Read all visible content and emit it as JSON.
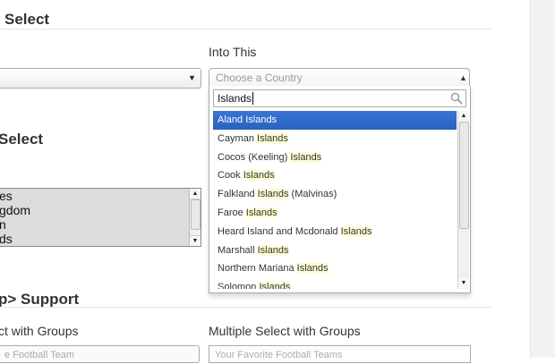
{
  "sections": {
    "standard_select": "Select",
    "multiple_select": "Select",
    "optgroup_support": "p> Support"
  },
  "into_this_label": "Into This",
  "left_select": {
    "value": ""
  },
  "multi_select_options": [
    "es",
    "gdom",
    "n",
    "ds"
  ],
  "chosen": {
    "placeholder": "Choose a Country",
    "search_value": "Islands",
    "results": [
      {
        "pre": "Aland ",
        "hl": "Islands",
        "post": "",
        "active": true
      },
      {
        "pre": "Cayman ",
        "hl": "Islands",
        "post": ""
      },
      {
        "pre": "Cocos (Keeling) ",
        "hl": "Islands",
        "post": ""
      },
      {
        "pre": "Cook ",
        "hl": "Islands",
        "post": ""
      },
      {
        "pre": "Falkland ",
        "hl": "Islands",
        "post": " (Malvinas)"
      },
      {
        "pre": "Faroe ",
        "hl": "Islands",
        "post": ""
      },
      {
        "pre": "Heard Island and Mcdonald ",
        "hl": "Islands",
        "post": ""
      },
      {
        "pre": "Marshall ",
        "hl": "Islands",
        "post": ""
      },
      {
        "pre": "Northern Mariana ",
        "hl": "Islands",
        "post": ""
      },
      {
        "pre": "Solomon ",
        "hl": "Islands",
        "post": ""
      }
    ]
  },
  "groups": {
    "left_label": "ct with Groups",
    "right_label": "Multiple Select with Groups",
    "left_placeholder": "e Football Team",
    "right_placeholder": "Your Favorite Football Teams"
  },
  "icons": {
    "caret_down": "▼",
    "caret_up": "▲",
    "search": "search-icon"
  }
}
